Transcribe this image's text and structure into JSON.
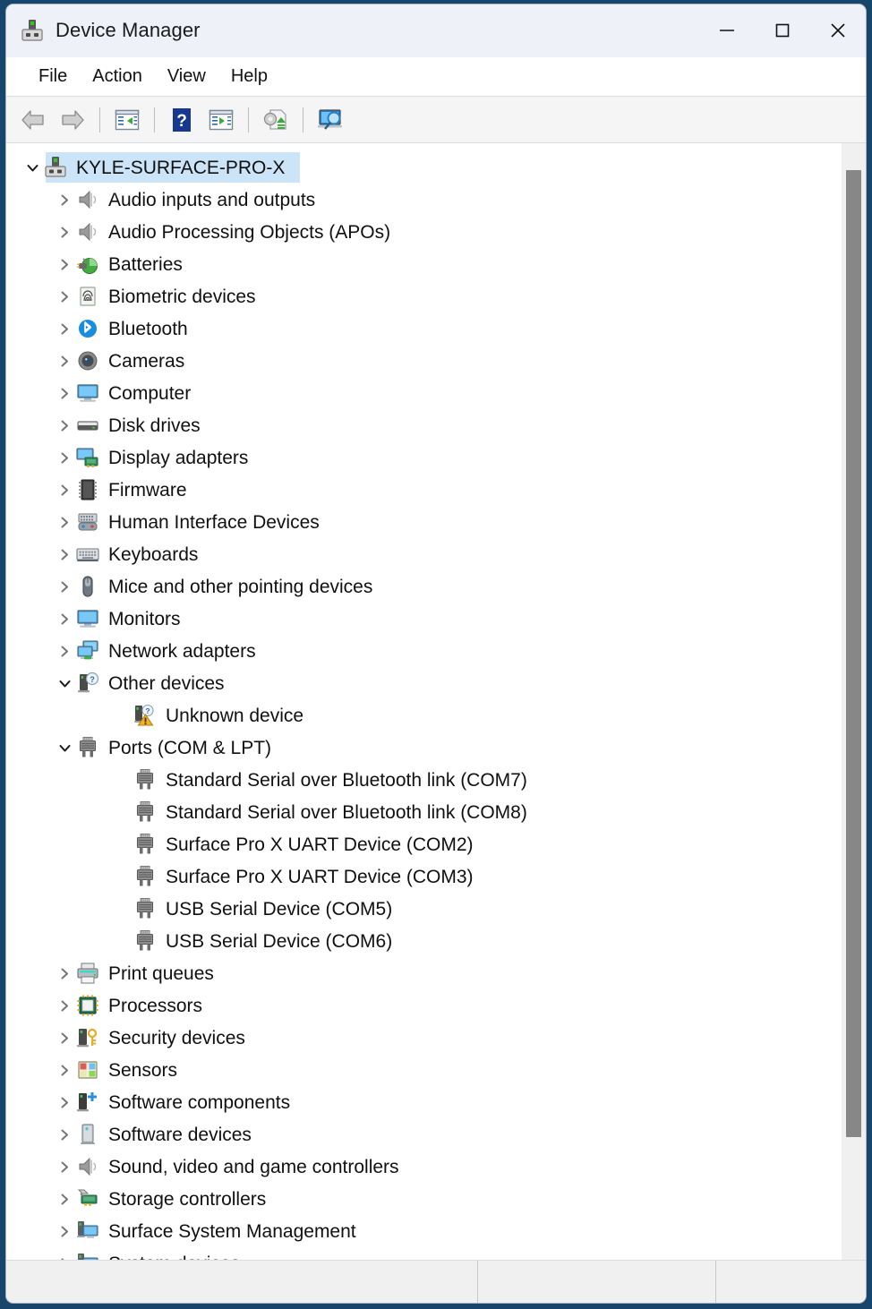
{
  "window": {
    "title": "Device Manager",
    "icon": "device-manager-icon",
    "controls": {
      "minimize": "minimize-button",
      "maximize": "maximize-button",
      "close": "close-button"
    }
  },
  "menubar": {
    "items": [
      {
        "label": "File"
      },
      {
        "label": "Action"
      },
      {
        "label": "View"
      },
      {
        "label": "Help"
      }
    ]
  },
  "toolbar": {
    "buttons": [
      {
        "name": "back-button",
        "icon": "back-arrow-icon"
      },
      {
        "name": "forward-button",
        "icon": "forward-arrow-icon"
      },
      {
        "name": "separator-1",
        "icon": "separator"
      },
      {
        "name": "show-hide-console-tree-button",
        "icon": "console-tree-icon"
      },
      {
        "name": "separator-2",
        "icon": "separator"
      },
      {
        "name": "help-button",
        "icon": "question-mark-icon"
      },
      {
        "name": "properties-button",
        "icon": "properties-icon"
      },
      {
        "name": "separator-3",
        "icon": "separator"
      },
      {
        "name": "update-driver-button",
        "icon": "update-driver-icon"
      },
      {
        "name": "separator-4",
        "icon": "separator"
      },
      {
        "name": "scan-for-hardware-changes-button",
        "icon": "scan-hardware-icon"
      }
    ]
  },
  "tree": {
    "root": {
      "label": "KYLE-SURFACE-PRO-X",
      "icon": "computer-root-icon",
      "expanded": true,
      "selected": true
    },
    "nodes": [
      {
        "label": "Audio inputs and outputs",
        "icon": "speaker-icon",
        "level": 1,
        "state": "collapsed"
      },
      {
        "label": "Audio Processing Objects (APOs)",
        "icon": "speaker-icon",
        "level": 1,
        "state": "collapsed"
      },
      {
        "label": "Batteries",
        "icon": "battery-icon",
        "level": 1,
        "state": "collapsed"
      },
      {
        "label": "Biometric devices",
        "icon": "fingerprint-icon",
        "level": 1,
        "state": "collapsed"
      },
      {
        "label": "Bluetooth",
        "icon": "bluetooth-icon",
        "level": 1,
        "state": "collapsed"
      },
      {
        "label": "Cameras",
        "icon": "camera-icon",
        "level": 1,
        "state": "collapsed"
      },
      {
        "label": "Computer",
        "icon": "monitor-icon",
        "level": 1,
        "state": "collapsed"
      },
      {
        "label": "Disk drives",
        "icon": "disk-drive-icon",
        "level": 1,
        "state": "collapsed"
      },
      {
        "label": "Display adapters",
        "icon": "display-adapter-icon",
        "level": 1,
        "state": "collapsed"
      },
      {
        "label": "Firmware",
        "icon": "firmware-chip-icon",
        "level": 1,
        "state": "collapsed"
      },
      {
        "label": "Human Interface Devices",
        "icon": "hid-icon",
        "level": 1,
        "state": "collapsed"
      },
      {
        "label": "Keyboards",
        "icon": "keyboard-icon",
        "level": 1,
        "state": "collapsed"
      },
      {
        "label": "Mice and other pointing devices",
        "icon": "mouse-icon",
        "level": 1,
        "state": "collapsed"
      },
      {
        "label": "Monitors",
        "icon": "monitor-icon",
        "level": 1,
        "state": "collapsed"
      },
      {
        "label": "Network adapters",
        "icon": "network-adapter-icon",
        "level": 1,
        "state": "collapsed"
      },
      {
        "label": "Other devices",
        "icon": "other-devices-icon",
        "level": 1,
        "state": "expanded"
      },
      {
        "label": "Unknown device",
        "icon": "unknown-device-warning-icon",
        "level": 2,
        "state": "leaf"
      },
      {
        "label": "Ports (COM & LPT)",
        "icon": "port-icon",
        "level": 1,
        "state": "expanded"
      },
      {
        "label": "Standard Serial over Bluetooth link (COM7)",
        "icon": "port-icon",
        "level": 2,
        "state": "leaf"
      },
      {
        "label": "Standard Serial over Bluetooth link (COM8)",
        "icon": "port-icon",
        "level": 2,
        "state": "leaf"
      },
      {
        "label": "Surface Pro X UART Device (COM2)",
        "icon": "port-icon",
        "level": 2,
        "state": "leaf"
      },
      {
        "label": "Surface Pro X UART Device (COM3)",
        "icon": "port-icon",
        "level": 2,
        "state": "leaf"
      },
      {
        "label": "USB Serial Device (COM5)",
        "icon": "port-icon",
        "level": 2,
        "state": "leaf"
      },
      {
        "label": "USB Serial Device (COM6)",
        "icon": "port-icon",
        "level": 2,
        "state": "leaf"
      },
      {
        "label": "Print queues",
        "icon": "printer-icon",
        "level": 1,
        "state": "collapsed"
      },
      {
        "label": "Processors",
        "icon": "processor-icon",
        "level": 1,
        "state": "collapsed"
      },
      {
        "label": "Security devices",
        "icon": "security-key-icon",
        "level": 1,
        "state": "collapsed"
      },
      {
        "label": "Sensors",
        "icon": "sensor-icon",
        "level": 1,
        "state": "collapsed"
      },
      {
        "label": "Software components",
        "icon": "software-component-icon",
        "level": 1,
        "state": "collapsed"
      },
      {
        "label": "Software devices",
        "icon": "software-device-icon",
        "level": 1,
        "state": "collapsed"
      },
      {
        "label": "Sound, video and game controllers",
        "icon": "speaker-icon",
        "level": 1,
        "state": "collapsed"
      },
      {
        "label": "Storage controllers",
        "icon": "storage-controller-icon",
        "level": 1,
        "state": "collapsed"
      },
      {
        "label": "Surface System Management",
        "icon": "surface-system-icon",
        "level": 1,
        "state": "collapsed"
      },
      {
        "label": "System devices",
        "icon": "system-device-icon",
        "level": 1,
        "state": "collapsed"
      }
    ]
  },
  "statusbar": {
    "panes": [
      "",
      "",
      ""
    ]
  },
  "colors": {
    "titlebar_bg": "#eef1f8",
    "selection": "#cce4f7",
    "toolbar_bg": "#f5f5f5",
    "statusbar_bg": "#f0f0f0",
    "scrollbar_thumb": "#878787",
    "text": "#101010"
  }
}
